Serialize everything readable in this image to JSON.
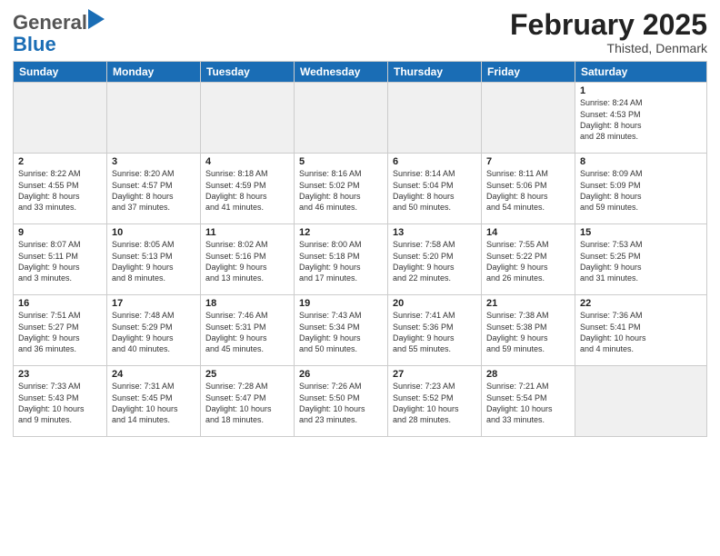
{
  "header": {
    "logo_general": "General",
    "logo_blue": "Blue",
    "month_title": "February 2025",
    "subtitle": "Thisted, Denmark"
  },
  "weekdays": [
    "Sunday",
    "Monday",
    "Tuesday",
    "Wednesday",
    "Thursday",
    "Friday",
    "Saturday"
  ],
  "rows": [
    [
      {
        "day": "",
        "info": ""
      },
      {
        "day": "",
        "info": ""
      },
      {
        "day": "",
        "info": ""
      },
      {
        "day": "",
        "info": ""
      },
      {
        "day": "",
        "info": ""
      },
      {
        "day": "",
        "info": ""
      },
      {
        "day": "1",
        "info": "Sunrise: 8:24 AM\nSunset: 4:53 PM\nDaylight: 8 hours\nand 28 minutes."
      }
    ],
    [
      {
        "day": "2",
        "info": "Sunrise: 8:22 AM\nSunset: 4:55 PM\nDaylight: 8 hours\nand 33 minutes."
      },
      {
        "day": "3",
        "info": "Sunrise: 8:20 AM\nSunset: 4:57 PM\nDaylight: 8 hours\nand 37 minutes."
      },
      {
        "day": "4",
        "info": "Sunrise: 8:18 AM\nSunset: 4:59 PM\nDaylight: 8 hours\nand 41 minutes."
      },
      {
        "day": "5",
        "info": "Sunrise: 8:16 AM\nSunset: 5:02 PM\nDaylight: 8 hours\nand 46 minutes."
      },
      {
        "day": "6",
        "info": "Sunrise: 8:14 AM\nSunset: 5:04 PM\nDaylight: 8 hours\nand 50 minutes."
      },
      {
        "day": "7",
        "info": "Sunrise: 8:11 AM\nSunset: 5:06 PM\nDaylight: 8 hours\nand 54 minutes."
      },
      {
        "day": "8",
        "info": "Sunrise: 8:09 AM\nSunset: 5:09 PM\nDaylight: 8 hours\nand 59 minutes."
      }
    ],
    [
      {
        "day": "9",
        "info": "Sunrise: 8:07 AM\nSunset: 5:11 PM\nDaylight: 9 hours\nand 3 minutes."
      },
      {
        "day": "10",
        "info": "Sunrise: 8:05 AM\nSunset: 5:13 PM\nDaylight: 9 hours\nand 8 minutes."
      },
      {
        "day": "11",
        "info": "Sunrise: 8:02 AM\nSunset: 5:16 PM\nDaylight: 9 hours\nand 13 minutes."
      },
      {
        "day": "12",
        "info": "Sunrise: 8:00 AM\nSunset: 5:18 PM\nDaylight: 9 hours\nand 17 minutes."
      },
      {
        "day": "13",
        "info": "Sunrise: 7:58 AM\nSunset: 5:20 PM\nDaylight: 9 hours\nand 22 minutes."
      },
      {
        "day": "14",
        "info": "Sunrise: 7:55 AM\nSunset: 5:22 PM\nDaylight: 9 hours\nand 26 minutes."
      },
      {
        "day": "15",
        "info": "Sunrise: 7:53 AM\nSunset: 5:25 PM\nDaylight: 9 hours\nand 31 minutes."
      }
    ],
    [
      {
        "day": "16",
        "info": "Sunrise: 7:51 AM\nSunset: 5:27 PM\nDaylight: 9 hours\nand 36 minutes."
      },
      {
        "day": "17",
        "info": "Sunrise: 7:48 AM\nSunset: 5:29 PM\nDaylight: 9 hours\nand 40 minutes."
      },
      {
        "day": "18",
        "info": "Sunrise: 7:46 AM\nSunset: 5:31 PM\nDaylight: 9 hours\nand 45 minutes."
      },
      {
        "day": "19",
        "info": "Sunrise: 7:43 AM\nSunset: 5:34 PM\nDaylight: 9 hours\nand 50 minutes."
      },
      {
        "day": "20",
        "info": "Sunrise: 7:41 AM\nSunset: 5:36 PM\nDaylight: 9 hours\nand 55 minutes."
      },
      {
        "day": "21",
        "info": "Sunrise: 7:38 AM\nSunset: 5:38 PM\nDaylight: 9 hours\nand 59 minutes."
      },
      {
        "day": "22",
        "info": "Sunrise: 7:36 AM\nSunset: 5:41 PM\nDaylight: 10 hours\nand 4 minutes."
      }
    ],
    [
      {
        "day": "23",
        "info": "Sunrise: 7:33 AM\nSunset: 5:43 PM\nDaylight: 10 hours\nand 9 minutes."
      },
      {
        "day": "24",
        "info": "Sunrise: 7:31 AM\nSunset: 5:45 PM\nDaylight: 10 hours\nand 14 minutes."
      },
      {
        "day": "25",
        "info": "Sunrise: 7:28 AM\nSunset: 5:47 PM\nDaylight: 10 hours\nand 18 minutes."
      },
      {
        "day": "26",
        "info": "Sunrise: 7:26 AM\nSunset: 5:50 PM\nDaylight: 10 hours\nand 23 minutes."
      },
      {
        "day": "27",
        "info": "Sunrise: 7:23 AM\nSunset: 5:52 PM\nDaylight: 10 hours\nand 28 minutes."
      },
      {
        "day": "28",
        "info": "Sunrise: 7:21 AM\nSunset: 5:54 PM\nDaylight: 10 hours\nand 33 minutes."
      },
      {
        "day": "",
        "info": ""
      }
    ]
  ]
}
